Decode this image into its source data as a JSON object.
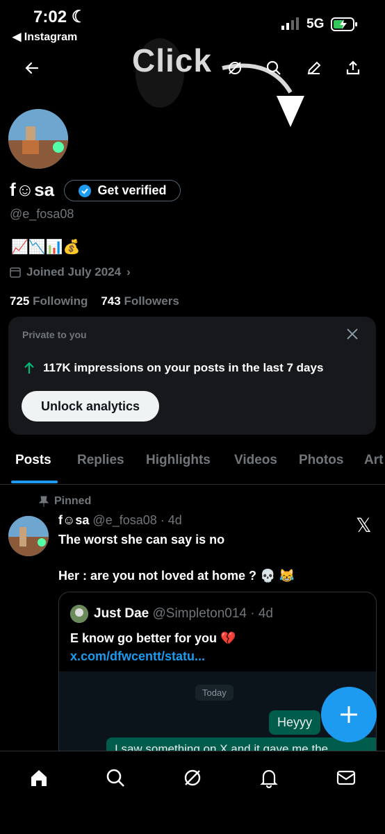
{
  "status_bar": {
    "time": "7:02",
    "back_app": "Instagram",
    "network": "5G"
  },
  "overlay": {
    "click_text": "Click"
  },
  "header": {
    "icons": [
      "back-arrow-icon",
      "grok-icon",
      "search-icon",
      "edit-icon",
      "share-icon"
    ]
  },
  "profile": {
    "name": "f☺sa",
    "get_verified": "Get verified",
    "handle": "@e_fosa08",
    "bio_emojis": "📈📉📊💰",
    "joined": "Joined July 2024",
    "following_count": "725",
    "following_label": "Following",
    "followers_count": "743",
    "followers_label": "Followers"
  },
  "analytics_card": {
    "label": "Private to you",
    "impressions": "117K impressions on your posts in the last 7 days",
    "unlock": "Unlock analytics"
  },
  "tabs": [
    "Posts",
    "Replies",
    "Highlights",
    "Videos",
    "Photos",
    "Art"
  ],
  "pinned_post": {
    "pinned_label": "Pinned",
    "author": "f☺sa",
    "handle_time": "@e_fosa08 · 4d",
    "text1": "The worst she can say is no",
    "text2": "Her : are you not loved at home ? 💀 😹",
    "quote": {
      "author": "Just Dae",
      "handle_time": "@Simpleton014 · 4d",
      "text": "E know go better for you 💔",
      "link": "x.com/dfwcentt/statu...",
      "chat_date": "Today",
      "bubble1": "Heyyy",
      "bubble2": "I saw something on X and it gave me the"
    }
  },
  "colors": {
    "accent": "#1d9bf0",
    "background": "#000000",
    "muted": "#71767b"
  }
}
